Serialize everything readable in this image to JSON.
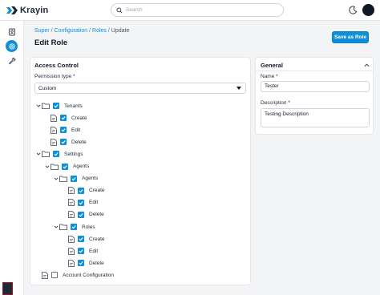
{
  "app": {
    "name": "Krayin"
  },
  "search": {
    "placeholder": "Search"
  },
  "breadcrumb": {
    "items": [
      "Super",
      "Configuration",
      "Roles"
    ],
    "current": "Update"
  },
  "page": {
    "title": "Edit Role",
    "save_label": "Save as Role"
  },
  "access_control": {
    "title": "Access Control",
    "permission_label": "Permission type",
    "permission_value": "Custom",
    "tree": [
      {
        "label": "Tenants",
        "kind": "folder",
        "checked": true,
        "level": 0
      },
      {
        "label": "Create",
        "kind": "doc",
        "checked": true,
        "level": 1
      },
      {
        "label": "Edit",
        "kind": "doc",
        "checked": true,
        "level": 1
      },
      {
        "label": "Delete",
        "kind": "doc",
        "checked": true,
        "level": 1
      },
      {
        "label": "Settings",
        "kind": "folder",
        "checked": true,
        "level": 0
      },
      {
        "label": "Agents",
        "kind": "folder",
        "checked": true,
        "level": 1
      },
      {
        "label": "Agents",
        "kind": "folder",
        "checked": true,
        "level": 2
      },
      {
        "label": "Create",
        "kind": "doc",
        "checked": true,
        "level": 3
      },
      {
        "label": "Edit",
        "kind": "doc",
        "checked": true,
        "level": 3
      },
      {
        "label": "Delete",
        "kind": "doc",
        "checked": true,
        "level": 3
      },
      {
        "label": "Roles",
        "kind": "folder",
        "checked": true,
        "level": 2
      },
      {
        "label": "Create",
        "kind": "doc",
        "checked": true,
        "level": 3
      },
      {
        "label": "Edit",
        "kind": "doc",
        "checked": true,
        "level": 3
      },
      {
        "label": "Delete",
        "kind": "doc",
        "checked": true,
        "level": 3
      },
      {
        "label": "Account Configuration",
        "kind": "doc",
        "checked": false,
        "level": 0
      }
    ]
  },
  "general": {
    "title": "General",
    "name_label": "Name",
    "name_value": "Tester",
    "description_label": "Description",
    "description_value": "Testing Description"
  },
  "colors": {
    "accent": "#0e90d9",
    "background": "#f3f4f6"
  }
}
